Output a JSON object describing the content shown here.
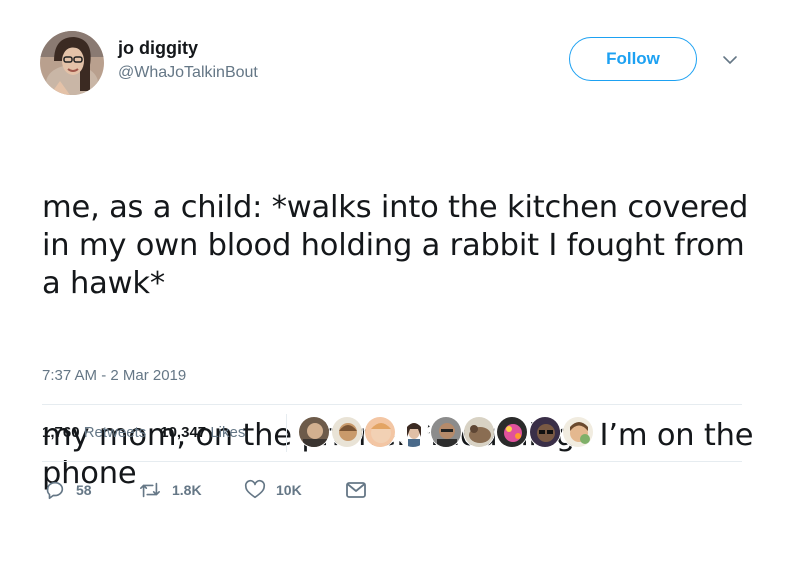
{
  "author": {
    "display_name": "jo diggity",
    "handle": "@WhaJoTalkinBout"
  },
  "follow_label": "Follow",
  "tweet": {
    "paragraphs": [
      "me, as a child: *walks into the kitchen covered in my own blood holding a rabbit I fought from a hawk*",
      "my mom, on the phone: *mouthing* I’m on the phone"
    ],
    "timestamp": "7:37 AM - 2 Mar 2019"
  },
  "stats": {
    "retweets_count": "1,760",
    "retweets_label": "Retweets",
    "likes_count": "10,347",
    "likes_label": "Likes"
  },
  "actions": {
    "reply_count": "58",
    "retweet_count": "1.8K",
    "like_count": "10K"
  },
  "colors": {
    "accent": "#1da1f2",
    "muted": "#657786",
    "text": "#14171a",
    "divider": "#e6ecf0"
  }
}
